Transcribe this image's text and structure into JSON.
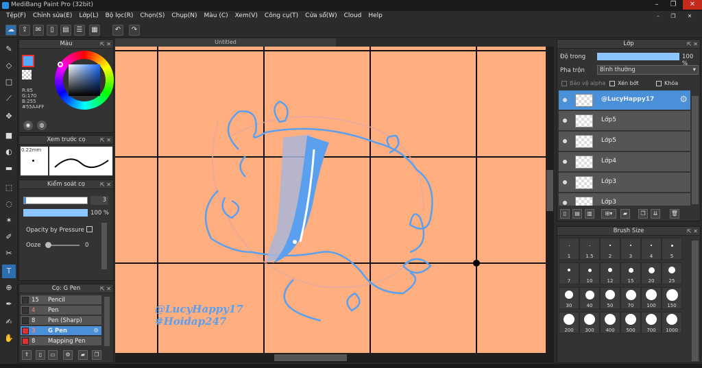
{
  "window": {
    "title": "MediBang Paint Pro (32bit)",
    "min": "–",
    "restore": "❐",
    "close": "✕",
    "sub_min": "–",
    "sub_restore": "❐",
    "sub_close": "✕"
  },
  "menu": [
    "Tệp(F)",
    "Chỉnh sửa(E)",
    "Lớp(L)",
    "Bộ lọc(R)",
    "Chọn(S)",
    "Chụp(N)",
    "Màu (C)",
    "Xem(V)",
    "Công cụ(T)",
    "Cửa sổ(W)",
    "Cloud",
    "Help"
  ],
  "colors": {
    "accent": "#4a90d9",
    "canvas_bg": "#ffae80",
    "stroke": "#5aa0ee",
    "current": "#55AAFF"
  },
  "color_panel": {
    "title": "Màu",
    "r": "R:85",
    "g": "G:170",
    "b": "B:255",
    "hex": "#55AAFF"
  },
  "brush_preview": {
    "title": "Xem trước cọ",
    "size": "0.22mm"
  },
  "brush_control": {
    "title": "Kiểm soát cọ",
    "size_value": "3",
    "opacity_value": "100 %",
    "opacity_pressure": "Opacity by Pressure",
    "ooze": "Ooze",
    "ooze_value": "0"
  },
  "brush_list": {
    "title": "Cọ: G Pen",
    "items": [
      {
        "size": "15",
        "name": "Pencil",
        "color": "#333333",
        "selected": false
      },
      {
        "size": "4",
        "name": "Pen",
        "color": "#333333",
        "selected": false
      },
      {
        "size": "8",
        "name": "Pen (Sharp)",
        "color": "#333333",
        "selected": false
      },
      {
        "size": "3",
        "name": "G Pen",
        "color": "#e03030",
        "selected": true
      },
      {
        "size": "8",
        "name": "Mapping Pen",
        "color": "#e03030",
        "selected": false
      }
    ]
  },
  "canvas": {
    "tab": "Untitled",
    "sig1": "@LucyHappy17",
    "sig2": "#Hoidap247"
  },
  "layer_panel": {
    "title": "Lớp",
    "opacity_label": "Độ trong",
    "opacity_value": "100 %",
    "blend_label": "Pha trộn",
    "blend_value": "Bình thường",
    "protect_alpha": "Bảo vệ alpha",
    "clipping": "Xén bớt",
    "lock": "Khóa",
    "layers": [
      {
        "name": "@LucyHappy17",
        "selected": true
      },
      {
        "name": "Lớp5",
        "selected": false
      },
      {
        "name": "Lớp5",
        "selected": false
      },
      {
        "name": "Lớp4",
        "selected": false
      },
      {
        "name": "Lớp3",
        "selected": false
      },
      {
        "name": "Lớp3",
        "selected": false
      }
    ]
  },
  "brush_size_panel": {
    "title": "Brush Size",
    "sizes": [
      "1",
      "1.5",
      "2",
      "3",
      "4",
      "5",
      "7",
      "10",
      "12",
      "15",
      "20",
      "25",
      "30",
      "40",
      "50",
      "70",
      "100",
      "150",
      "200",
      "300",
      "400",
      "500",
      "700",
      "1000"
    ]
  }
}
